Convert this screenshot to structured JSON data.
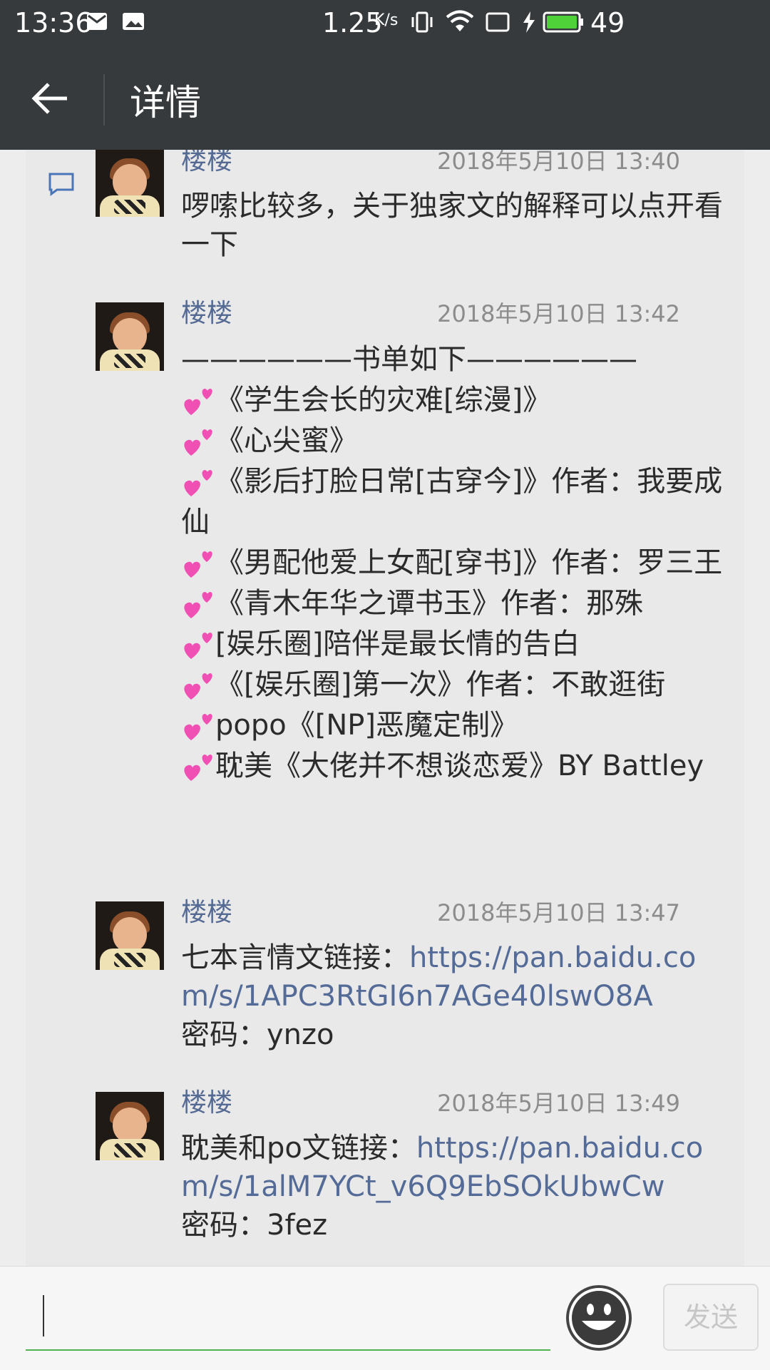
{
  "status_bar": {
    "time": "13:36",
    "speed": "1.25",
    "speed_unit": "K/s",
    "battery": "49"
  },
  "header": {
    "title": "详情"
  },
  "messages": [
    {
      "name": "楼楼",
      "time": "2018年5月10日 13:40",
      "lines": [
        "啰嗦比较多，关于独家文的解释可以点开看一下"
      ]
    },
    {
      "name": "楼楼",
      "time": "2018年5月10日 13:42",
      "lines": [
        "——————书单如下——————",
        "《学生会长的灾难[综漫]》",
        "《心尖蜜》",
        "《影后打脸日常[古穿今]》作者：我要成仙",
        "《男配他爱上女配[穿书]》作者：罗三王",
        "《青木年华之谭书玉》作者：那殊",
        "[娱乐圈]陪伴是最长情的告白",
        "《[娱乐圈]第一次》作者：不敢逛街",
        "popo《[NP]恶魔定制》",
        "耽美《大佬并不想谈恋爱》BY Battley"
      ]
    },
    {
      "name": "楼楼",
      "time": "2018年5月10日 13:47",
      "prefix": "七本言情文链接：",
      "link": "https://pan.baidu.com/s/1APC3RtGI6n7AGe40lswO8A",
      "password": "密码：ynzo"
    },
    {
      "name": "楼楼",
      "time": "2018年5月10日 13:49",
      "prefix": "耽美和po文链接：",
      "link": "https://pan.baidu.com/s/1alM7YCt_v6Q9EbSOkUbwCw",
      "password": "密码：3fez"
    }
  ],
  "input_bar": {
    "placeholder": "",
    "send_label": "发送"
  },
  "colors": {
    "header_bg": "#373a3d",
    "link": "#536b96",
    "name": "#556a93",
    "input_underline": "#4fb34f"
  }
}
